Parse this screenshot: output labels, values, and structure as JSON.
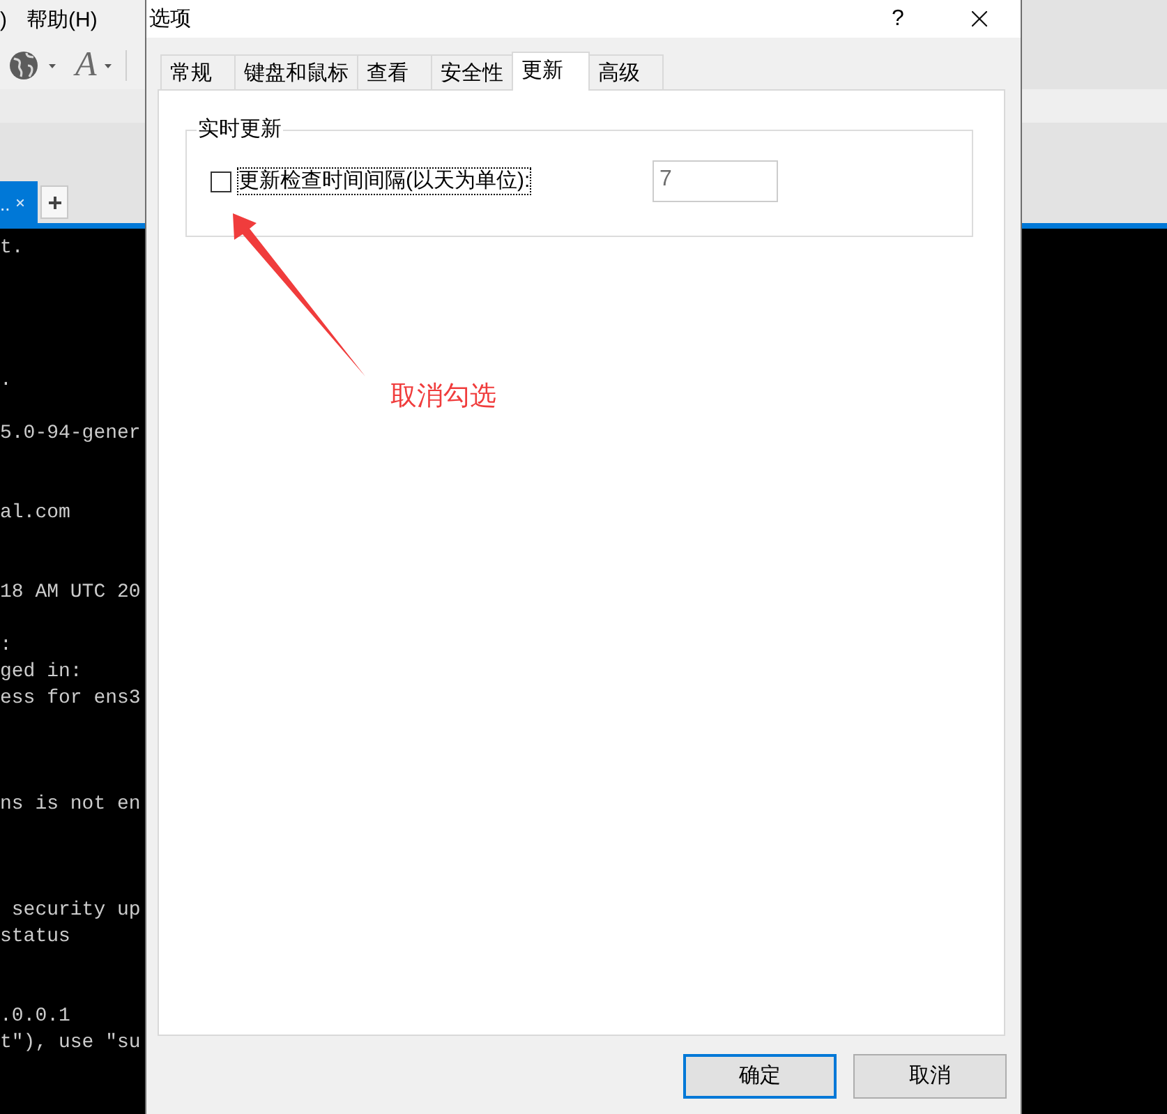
{
  "background_app": {
    "menu_items": [
      {
        "label": ")"
      },
      {
        "label": "帮助(H)"
      }
    ],
    "toolbar": {
      "font_glyph": "A"
    },
    "tabs": [
      {
        "label": "..",
        "selected": true
      }
    ],
    "terminal_lines": [
      "t.",
      ".",
      "5.0-94-gener",
      "al.com",
      "18 AM UTC 20",
      ":",
      "ged in:",
      "ess for ens3",
      "ns is not en",
      " security up",
      "status",
      ".0.0.1",
      "t\"), use \"su"
    ]
  },
  "dialog": {
    "title": "选项",
    "help_button": "?",
    "tabs": [
      {
        "label": "常规",
        "selected": false
      },
      {
        "label": "键盘和鼠标",
        "selected": false
      },
      {
        "label": "查看",
        "selected": false
      },
      {
        "label": "安全性",
        "selected": false
      },
      {
        "label": "更新",
        "selected": true
      },
      {
        "label": "高级",
        "selected": false
      }
    ],
    "update_group": {
      "title": "实时更新",
      "checkbox": {
        "label": "更新检查时间间隔(以天为单位):",
        "checked": false,
        "focused": true
      },
      "interval_field": {
        "value": "7",
        "disabled": true
      }
    },
    "buttons": [
      {
        "label": "确定",
        "default": true
      },
      {
        "label": "取消",
        "default": false
      }
    ]
  },
  "annotation": {
    "text": "取消勾选"
  }
}
